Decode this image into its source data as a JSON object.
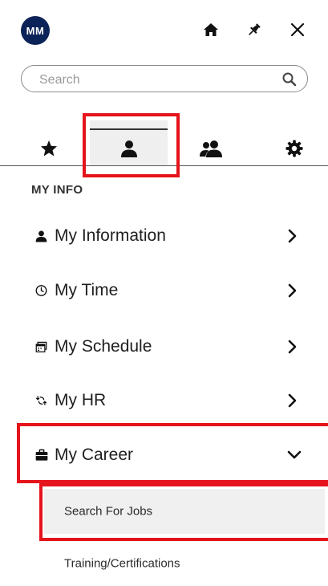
{
  "header": {
    "avatar_initials": "MM",
    "home_icon": "home-icon",
    "pin_icon": "pin-icon",
    "close_icon": "close-icon"
  },
  "search": {
    "placeholder": "Search",
    "icon": "search-icon"
  },
  "tabs": [
    {
      "icon": "star-icon",
      "selected": false
    },
    {
      "icon": "user-icon",
      "selected": true
    },
    {
      "icon": "users-icon",
      "selected": false
    },
    {
      "icon": "gear-icon",
      "selected": false
    }
  ],
  "section": {
    "title": "MY INFO"
  },
  "menu": [
    {
      "label": "My Information",
      "icon": "user-icon",
      "expanded": false
    },
    {
      "label": "My Time",
      "icon": "clock-icon",
      "expanded": false
    },
    {
      "label": "My Schedule",
      "icon": "calendar-icon",
      "expanded": false
    },
    {
      "label": "My HR",
      "icon": "hr-icon",
      "expanded": false
    },
    {
      "label": "My Career",
      "icon": "briefcase-icon",
      "expanded": true
    }
  ],
  "submenu": [
    {
      "label": "Search For Jobs",
      "selected": true
    },
    {
      "label": "Training/Certifications",
      "selected": false
    }
  ],
  "colors": {
    "avatar_bg": "#0b2358",
    "highlight": "#e5131b",
    "selected_bg": "#efefef"
  }
}
